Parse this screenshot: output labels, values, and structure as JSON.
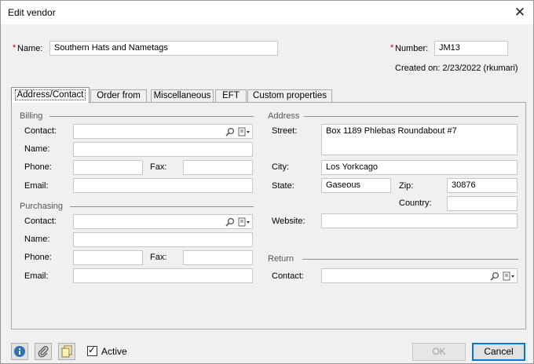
{
  "window": {
    "title": "Edit vendor",
    "close_glyph": "✕"
  },
  "header": {
    "name_label": "Name:",
    "name_value": "Southern  Hats and Nametags",
    "number_label": "Number:",
    "number_value": "JM13",
    "required_mark": "*",
    "created": "Created on: 2/23/2022 (rkumari)"
  },
  "tabs": [
    {
      "label": "Address/Contact"
    },
    {
      "label": "Order from"
    },
    {
      "label": "Miscellaneous"
    },
    {
      "label": "EFT"
    },
    {
      "label": "Custom properties"
    }
  ],
  "billing": {
    "group": "Billing",
    "contact_label": "Contact:",
    "contact_value": "",
    "name_label": "Name:",
    "name_value": "",
    "phone_label": "Phone:",
    "phone_value": "",
    "fax_label": "Fax:",
    "fax_value": "",
    "email_label": "Email:",
    "email_value": ""
  },
  "purchasing": {
    "group": "Purchasing",
    "contact_label": "Contact:",
    "contact_value": "",
    "name_label": "Name:",
    "name_value": "",
    "phone_label": "Phone:",
    "phone_value": "",
    "fax_label": "Fax:",
    "fax_value": "",
    "email_label": "Email:",
    "email_value": ""
  },
  "address": {
    "group": "Address",
    "street_label": "Street:",
    "street_value": "Box 1189 Phlebas Roundabout #7",
    "city_label": "City:",
    "city_value": "Los Yorkcago",
    "state_label": "State:",
    "state_value": "Gaseous",
    "zip_label": "Zip:",
    "zip_value": "30876",
    "country_label": "Country:",
    "country_value": "",
    "website_label": "Website:",
    "website_value": ""
  },
  "return": {
    "group": "Return",
    "contact_label": "Contact:",
    "contact_value": ""
  },
  "footer": {
    "active_label": "Active",
    "active_checked": true,
    "check_glyph": "✓",
    "ok_label": "OK",
    "cancel_label": "Cancel"
  },
  "icons": {
    "info": "info-icon",
    "attach": "paperclip-icon",
    "notes": "notes-icon",
    "lookup": "magnifier-icon",
    "menu": "address-card-dropdown-icon"
  },
  "colors": {
    "required": "#c00000",
    "accent": "#0078d7",
    "info_blue": "#2e6fb5"
  }
}
